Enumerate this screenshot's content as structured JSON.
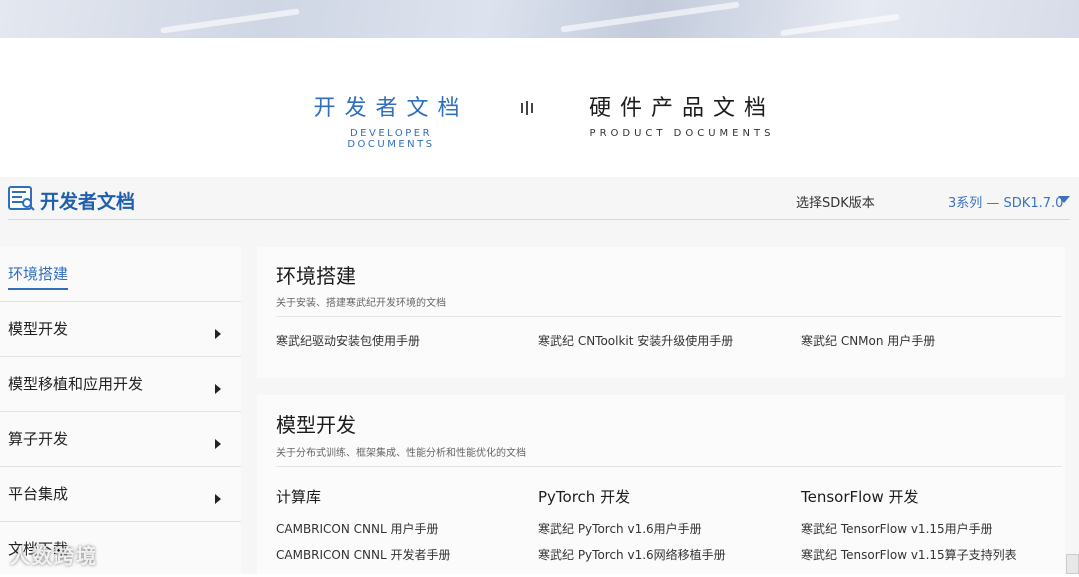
{
  "switcher": {
    "developer_cn": "开发者文档",
    "developer_en": "DEVELOPER DOCUMENTS",
    "product_cn": "硬件产品文档",
    "product_en": "PRODUCT DOCUMENTS"
  },
  "header": {
    "title": "开发者文档",
    "sdk_label": "选择SDK版本",
    "sdk_value": "3系列 — SDK1.7.0"
  },
  "sidebar": {
    "items": [
      {
        "label": "环境搭建",
        "active": true
      },
      {
        "label": "模型开发"
      },
      {
        "label": "模型移植和应用开发"
      },
      {
        "label": "算子开发"
      },
      {
        "label": "平台集成"
      },
      {
        "label": "文档下载"
      }
    ]
  },
  "env": {
    "title": "环境搭建",
    "desc": "关于安装、搭建寒武纪开发环境的文档",
    "links": [
      "寒武纪驱动安装包使用手册",
      "寒武纪 CNToolkit 安装升级使用手册",
      "寒武纪 CNMon 用户手册"
    ]
  },
  "model": {
    "title": "模型开发",
    "desc": "关于分布式训练、框架集成、性能分析和性能优化的文档",
    "columns": [
      {
        "heading": "计算库",
        "links": [
          "CAMBRICON CNNL 用户手册",
          "CAMBRICON CNNL 开发者手册"
        ]
      },
      {
        "heading": "PyTorch 开发",
        "links": [
          "寒武纪 PyTorch v1.6用户手册",
          "寒武纪 PyTorch v1.6网络移植手册"
        ]
      },
      {
        "heading": "TensorFlow 开发",
        "links": [
          "寒武纪 TensorFlow v1.15用户手册",
          "寒武纪 TensorFlow v1.15算子支持列表"
        ]
      }
    ]
  },
  "watermark": "人数跨境"
}
